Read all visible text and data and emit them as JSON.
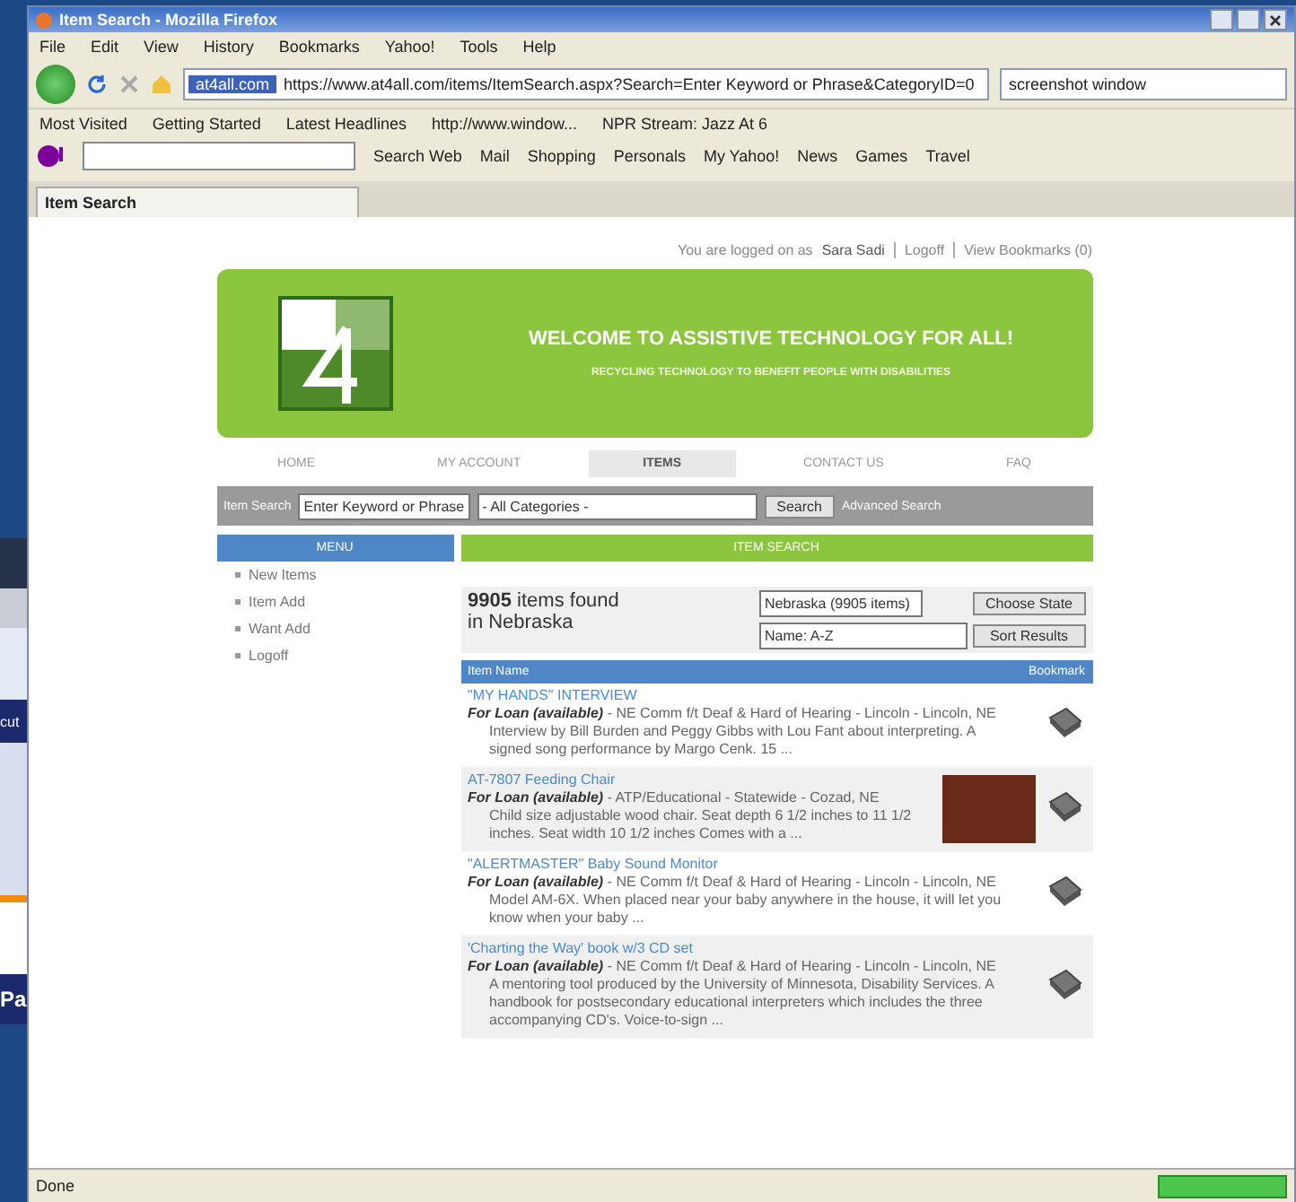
{
  "background_window": {
    "texts": [
      "cut",
      "Pa"
    ]
  },
  "window": {
    "title": "Item Search - Mozilla Firefox"
  },
  "menu_bar": [
    "File",
    "Edit",
    "View",
    "History",
    "Bookmarks",
    "Yahoo!",
    "Tools",
    "Help"
  ],
  "address_bar": {
    "site_label": "at4all.com",
    "url": "https://www.at4all.com/items/ItemSearch.aspx?Search=Enter Keyword or Phrase&CategoryID=0"
  },
  "web_search": {
    "value": "screenshot window"
  },
  "bookmarks": [
    "Most Visited",
    "Getting Started",
    "Latest Headlines",
    "http://www.window...",
    "NPR Stream: Jazz At 6"
  ],
  "yahoo_toolbar": [
    "Search Web",
    "Mail",
    "Shopping",
    "Personals",
    "My Yahoo!",
    "News",
    "Games",
    "Travel"
  ],
  "tabs": [
    {
      "label": "Item Search",
      "selected": true
    }
  ],
  "page": {
    "user_bar": {
      "text": "You are logged on as",
      "user": "Sara Sadi",
      "links": [
        "Logoff",
        "View Bookmarks (0)"
      ]
    },
    "banner": {
      "title": "WELCOME TO ASSISTIVE TECHNOLOGY FOR ALL!",
      "subtitle": "RECYCLING TECHNOLOGY TO BENEFIT PEOPLE WITH DISABILITIES"
    },
    "nav": [
      {
        "label": "HOME",
        "selected": false
      },
      {
        "label": "MY ACCOUNT",
        "selected": false
      },
      {
        "label": "ITEMS",
        "selected": true
      },
      {
        "label": "CONTACT US",
        "selected": false
      },
      {
        "label": "FAQ",
        "selected": false
      }
    ],
    "search_bar": {
      "label": "Item Search",
      "value": "Enter Keyword or Phrase",
      "category": "- All Categories -",
      "button": "Search",
      "advanced_link": "Advanced Search"
    },
    "menu": {
      "title": "MENU",
      "items": [
        "New Items",
        "Item Add",
        "Want Add",
        "Logoff"
      ]
    },
    "results": {
      "title": "ITEM SEARCH",
      "count": "9905",
      "count_text": "items found",
      "location": "in Nebraska",
      "state_select": "Nebraska (9905 items)",
      "state_button": "Choose State",
      "sort_select": "Name: A-Z",
      "sort_button": "Sort Results",
      "columns": [
        "Item Name",
        "Bookmark"
      ],
      "items": [
        {
          "name": "\"MY HANDS\" INTERVIEW",
          "status": "For Loan (available)",
          "location": "- NE Comm f/t Deaf & Hard of Hearing - Lincoln - Lincoln, NE",
          "description": "Interview by Bill Burden and Peggy Gibbs with Lou Fant about interpreting. A signed song performance by Margo Cenk. 15 ...",
          "photo": false
        },
        {
          "name": "AT-7807 Feeding Chair",
          "status": "For Loan (available)",
          "location": "- ATP/Educational - Statewide - Cozad, NE",
          "description": "Child size adjustable wood chair. Seat depth 6 1/2 inches to 11 1/2 inches. Seat width 10 1/2 inches Comes with a ...",
          "photo": true
        },
        {
          "name": "\"ALERTMASTER\" Baby Sound Monitor",
          "status": "For Loan (available)",
          "location": "- NE Comm f/t Deaf & Hard of Hearing - Lincoln - Lincoln, NE",
          "description": "Model AM-6X. When placed near your baby anywhere in the house, it will let you know when your baby ...",
          "photo": false
        },
        {
          "name": "'Charting the Way' book w/3 CD set",
          "status": "For Loan (available)",
          "location": "- NE Comm f/t Deaf & Hard of Hearing - Lincoln - Lincoln, NE",
          "description": "A mentoring tool produced by the University of Minnesota, Disability Services. A handbook for postsecondary educational interpreters which includes the three accompanying CD's. Voice-to-sign ...",
          "photo": false
        }
      ]
    }
  },
  "status_bar": {
    "text": "Done"
  }
}
